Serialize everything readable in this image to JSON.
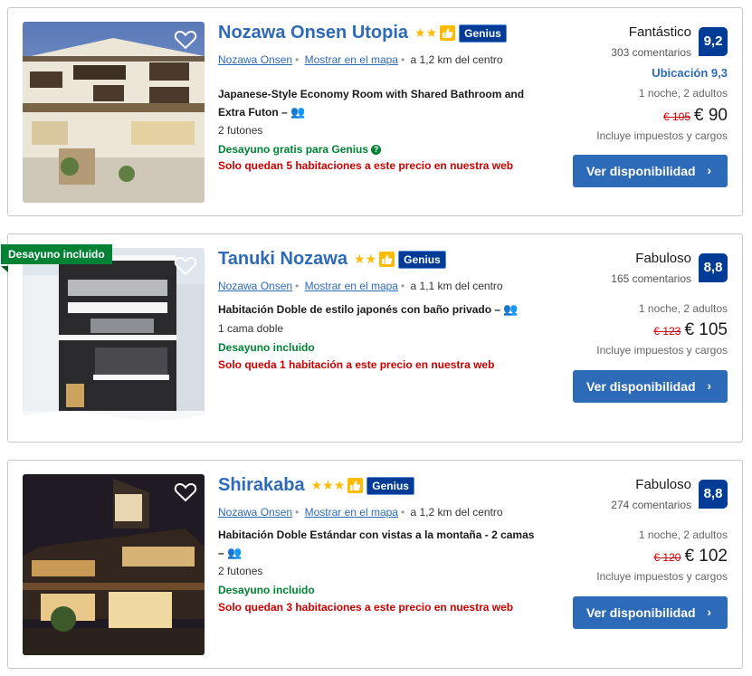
{
  "colors": {
    "link": "#2d6ab7",
    "genius": "#003b95",
    "score": "#003b95",
    "green": "#008234",
    "red": "#cc0000",
    "star": "#febb02",
    "button": "#2d6ab7"
  },
  "hotels": [
    {
      "name": "Nozawa Onsen Utopia",
      "stars": "★★",
      "genius_label": "Genius",
      "location": "Nozawa Onsen",
      "map_link": "Mostrar en el mapa",
      "distance": "a 1,2 km del centro",
      "room": "Japanese-Style Economy Room with Shared Bathroom and Extra Futon",
      "persons_icon": "👥",
      "beds": "2 futones",
      "breakfast": "Desayuno gratis para Genius",
      "availability": "Solo quedan 5 habitaciones a este precio en nuestra web",
      "rating_word": "Fantástico",
      "reviews": "303 comentarios",
      "score": "9,2",
      "location_score": "Ubicación 9,3",
      "nights": "1 noche, 2 adultos",
      "old_price": "€ 105",
      "price": "€ 90",
      "taxes": "Incluye impuestos y cargos",
      "button": "Ver disponibilidad",
      "favorite_icon": "heart-icon"
    },
    {
      "name": "Tanuki Nozawa",
      "stars": "★★",
      "genius_label": "Genius",
      "ribbon": "Desayuno incluido",
      "location": "Nozawa Onsen",
      "map_link": "Mostrar en el mapa",
      "distance": "a 1,1 km del centro",
      "room": "Habitación Doble de estilo japonés con baño privado",
      "persons_icon": "👥",
      "beds": "1 cama doble",
      "breakfast": "Desayuno incluido",
      "availability": "Solo queda 1 habitación a este precio en nuestra web",
      "rating_word": "Fabuloso",
      "reviews": "165 comentarios",
      "score": "8,8",
      "nights": "1 noche, 2 adultos",
      "old_price": "€ 123",
      "price": "€ 105",
      "taxes": "Incluye impuestos y cargos",
      "button": "Ver disponibilidad",
      "favorite_icon": "heart-icon"
    },
    {
      "name": "Shirakaba",
      "stars": "★★★",
      "genius_label": "Genius",
      "location": "Nozawa Onsen",
      "map_link": "Mostrar en el mapa",
      "distance": "a 1,2 km del centro",
      "room": "Habitación Doble Estándar con vistas a la montaña - 2 camas",
      "persons_icon": "👥",
      "beds": "2 futones",
      "breakfast": "Desayuno incluido",
      "availability": "Solo quedan 3 habitaciones a este precio en nuestra web",
      "rating_word": "Fabuloso",
      "reviews": "274 comentarios",
      "score": "8,8",
      "nights": "1 noche, 2 adultos",
      "old_price": "€ 120",
      "price": "€ 102",
      "taxes": "Incluye impuestos y cargos",
      "button": "Ver disponibilidad",
      "favorite_icon": "heart-icon"
    }
  ]
}
